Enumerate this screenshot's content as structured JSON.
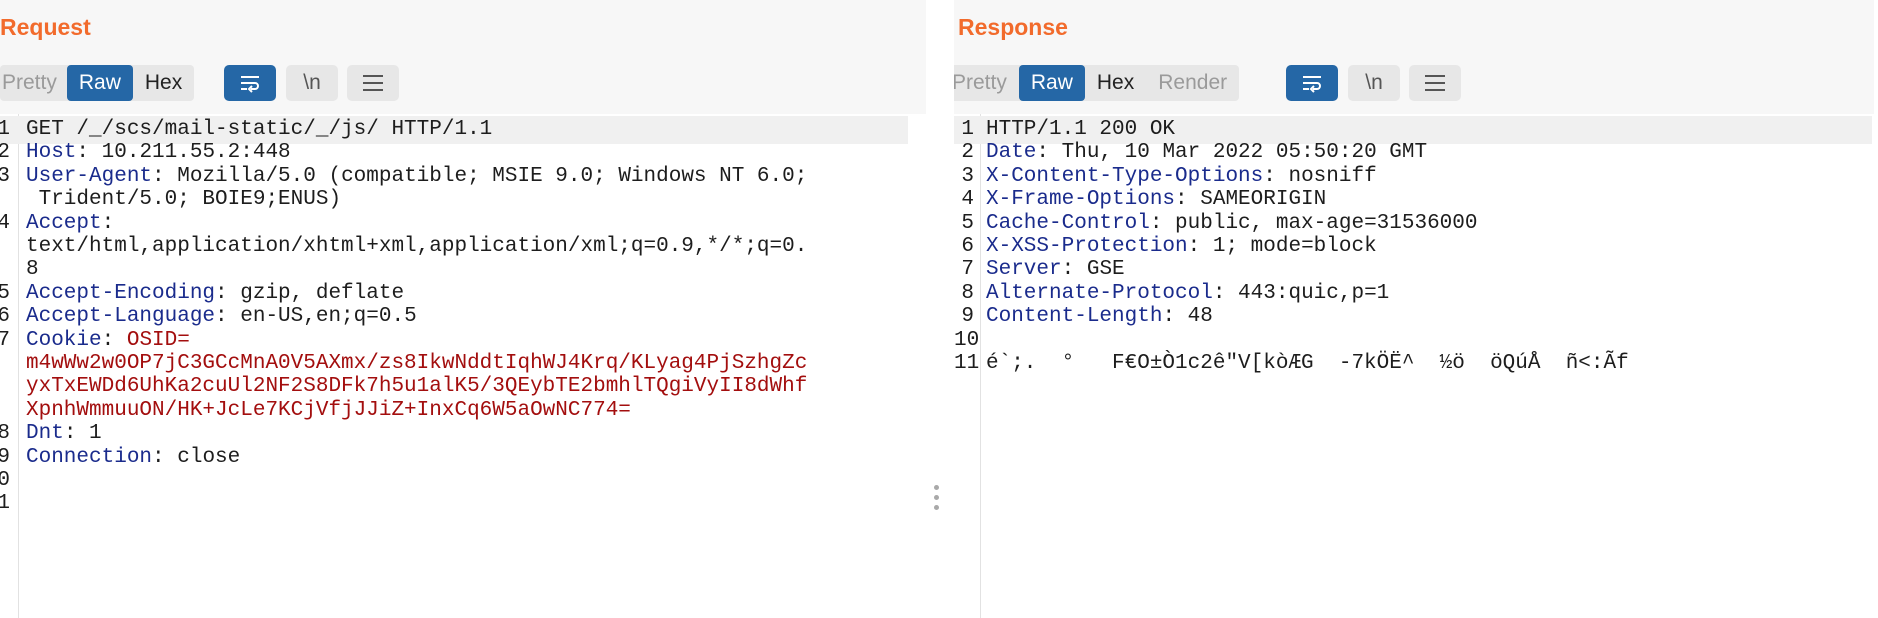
{
  "request": {
    "title": "Request",
    "tabs": [
      "Pretty",
      "Raw",
      "Hex"
    ],
    "active_tab": "Raw",
    "tools": {
      "wrap": "wrap-lines-icon",
      "newline": "\\n",
      "menu": "menu-icon"
    },
    "lines": [
      {
        "n": "1",
        "text": "GET /_/scs/mail-static/_/js/ HTTP/1.1"
      },
      {
        "n": "2",
        "key": "Host",
        "value": " 10.211.55.2:448"
      },
      {
        "n": "3",
        "key": "User-Agent",
        "value": " Mozilla/5.0 (compatible; MSIE 9.0; Windows NT 6.0;"
      },
      {
        "n": "",
        "text": " Trident/5.0; BOIE9;ENUS)"
      },
      {
        "n": "4",
        "key": "Accept",
        "value": ""
      },
      {
        "n": "",
        "text": "text/html,application/xhtml+xml,application/xml;q=0.9,*/*;q=0."
      },
      {
        "n": "",
        "text": "8"
      },
      {
        "n": "5",
        "key": "Accept-Encoding",
        "value": " gzip, deflate"
      },
      {
        "n": "6",
        "key": "Accept-Language",
        "value": " en-US,en;q=0.5"
      },
      {
        "n": "7",
        "key": "Cookie",
        "cookie": " OSID="
      },
      {
        "n": "",
        "cookie": "m4wWw2w0OP7jC3GCcMnA0V5AXmx/zs8IkwNddtIqhWJ4Krq/KLyag4PjSzhgZc"
      },
      {
        "n": "",
        "cookie": "yxTxEWDd6UhKa2cuUl2NF2S8DFk7h5u1alK5/3QEybTE2bmhlTQgiVyII8dWhf"
      },
      {
        "n": "",
        "cookie": "XpnhWmmuuON/HK+JcLe7KCjVfjJJiZ+InxCq6W5aOwNC774="
      },
      {
        "n": "8",
        "key": "Dnt",
        "value": " 1"
      },
      {
        "n": "9",
        "key": "Connection",
        "value": " close"
      },
      {
        "n": "0",
        "text": ""
      },
      {
        "n": "1",
        "text": ""
      }
    ]
  },
  "response": {
    "title": "Response",
    "tabs": [
      "Pretty",
      "Raw",
      "Hex",
      "Render"
    ],
    "active_tab": "Raw",
    "tools": {
      "wrap": "wrap-lines-icon",
      "newline": "\\n",
      "menu": "menu-icon"
    },
    "lines": [
      {
        "n": "1",
        "text": "HTTP/1.1 200 OK"
      },
      {
        "n": "2",
        "key": "Date",
        "value": " Thu, 10 Mar 2022 05:50:20 GMT"
      },
      {
        "n": "3",
        "key": "X-Content-Type-Options",
        "value": " nosniff"
      },
      {
        "n": "4",
        "key": "X-Frame-Options",
        "value": " SAMEORIGIN"
      },
      {
        "n": "5",
        "key": "Cache-Control",
        "value": " public, max-age=31536000"
      },
      {
        "n": "6",
        "key": "X-XSS-Protection",
        "value": " 1; mode=block"
      },
      {
        "n": "7",
        "key": "Server",
        "value": " GSE"
      },
      {
        "n": "8",
        "key": "Alternate-Protocol",
        "value": " 443:quic,p=1"
      },
      {
        "n": "9",
        "key": "Content-Length",
        "value": " 48"
      },
      {
        "n": "10",
        "text": ""
      },
      {
        "n": "11",
        "text": "é`;.  °   F€O±Ò1c2ê\"V[kòÆG  -7kÖË^  ½ö  öQúÅ  ñ<:Ãf"
      }
    ]
  },
  "layout_buttons": [
    "split-vertical-icon",
    "split-horizontal-icon",
    "single-pane-icon"
  ],
  "colors": {
    "accent": "#f26b2c",
    "active_tab": "#2567a6",
    "header_key": "#1a2b8c",
    "cookie_value": "#a30e0e"
  }
}
